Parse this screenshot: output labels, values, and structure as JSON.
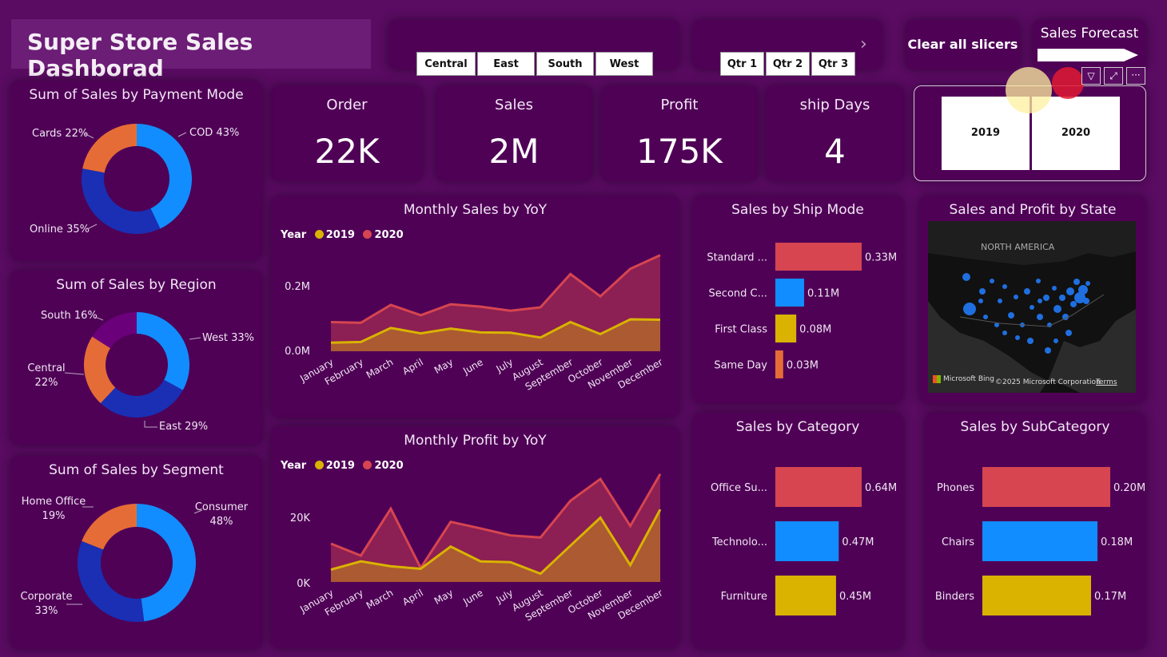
{
  "header": {
    "title": "Super Store Sales Dashborad"
  },
  "region_slicer": [
    "Central",
    "East",
    "South",
    "West"
  ],
  "quarter_slicer": [
    "Qtr 1",
    "Qtr 2",
    "Qtr 3"
  ],
  "clear_button": "Clear all slicers",
  "forecast": {
    "label": "Sales Forecast"
  },
  "kpis": [
    {
      "label": "Order",
      "value": "22K"
    },
    {
      "label": "Sales",
      "value": "2M"
    },
    {
      "label": "Profit",
      "value": "175K"
    },
    {
      "label": "ship Days",
      "value": "4"
    }
  ],
  "year_slicer": [
    "2019",
    "2020"
  ],
  "colors": {
    "bg": "#5a0b62",
    "panel": "#4f0156",
    "blue": "#118dff",
    "darkblue": "#1a2fb3",
    "orange": "#e66c37",
    "purple": "#6b007b",
    "red": "#d64550",
    "gold": "#d9b300"
  },
  "map": {
    "title": "Sales and Profit by State",
    "region_label": "NORTH AMERICA",
    "attribution": "Microsoft Bing",
    "copyright": "©2025 Microsoft Corporation",
    "terms": "Terms"
  },
  "chart_data": [
    {
      "id": "payment",
      "type": "pie",
      "title": "Sum of Sales by Payment Mode",
      "slices": [
        {
          "label": "COD 43%",
          "value": 43,
          "color": "#118dff"
        },
        {
          "label": "Online 35%",
          "value": 35,
          "color": "#1a2fb3"
        },
        {
          "label": "Cards 22%",
          "value": 22,
          "color": "#e66c37"
        }
      ]
    },
    {
      "id": "region",
      "type": "pie",
      "title": "Sum of Sales by Region",
      "slices": [
        {
          "label": "West 33%",
          "value": 33,
          "color": "#118dff"
        },
        {
          "label": "East 29%",
          "value": 29,
          "color": "#1a2fb3"
        },
        {
          "label": "Central 22%",
          "value": 22,
          "color": "#e66c37"
        },
        {
          "label": "South 16%",
          "value": 16,
          "color": "#6b007b"
        }
      ]
    },
    {
      "id": "segment",
      "type": "pie",
      "title": "Sum of Sales by Segment",
      "slices": [
        {
          "label": "Consumer 48%",
          "value": 48,
          "color": "#118dff"
        },
        {
          "label": "Corporate 33%",
          "value": 33,
          "color": "#1a2fb3"
        },
        {
          "label": "Home Office 19%",
          "value": 19,
          "color": "#e66c37"
        }
      ]
    },
    {
      "id": "monthly_sales",
      "type": "area",
      "title": "Monthly Sales by YoY",
      "legend_title": "Year",
      "categories": [
        "January",
        "February",
        "March",
        "April",
        "May",
        "June",
        "July",
        "August",
        "September",
        "October",
        "November",
        "December"
      ],
      "y_ticks": [
        "0.0M",
        "0.2M"
      ],
      "ylim": [
        0,
        0.3
      ],
      "series": [
        {
          "name": "2019",
          "color": "#d9b300",
          "values": [
            0.025,
            0.027,
            0.068,
            0.052,
            0.066,
            0.055,
            0.054,
            0.04,
            0.085,
            0.05,
            0.093,
            0.092
          ]
        },
        {
          "name": "2020",
          "color": "#d64550",
          "values": [
            0.085,
            0.083,
            0.135,
            0.105,
            0.137,
            0.13,
            0.118,
            0.128,
            0.225,
            0.16,
            0.24,
            0.28
          ]
        }
      ]
    },
    {
      "id": "monthly_profit",
      "type": "area",
      "title": "Monthly Profit by YoY",
      "legend_title": "Year",
      "categories": [
        "January",
        "February",
        "March",
        "April",
        "May",
        "June",
        "July",
        "August",
        "September",
        "October",
        "November",
        "December"
      ],
      "y_ticks": [
        "0K",
        "20K"
      ],
      "ylim": [
        0,
        25000
      ],
      "series": [
        {
          "name": "2019",
          "color": "#d9b300",
          "values": [
            3000,
            5000,
            3800,
            3200,
            8600,
            5000,
            4800,
            2000,
            8800,
            15600,
            4100,
            17600
          ]
        },
        {
          "name": "2020",
          "color": "#d64550",
          "values": [
            9300,
            6400,
            17800,
            3400,
            14600,
            13000,
            11300,
            10800,
            19700,
            25000,
            13600,
            26200
          ]
        }
      ]
    },
    {
      "id": "ship_mode",
      "type": "bar",
      "title": "Sales by Ship Mode",
      "xlim": [
        0,
        0.33
      ],
      "bars": [
        {
          "category": "Standard ...",
          "value": 0.33,
          "label": "0.33M",
          "color": "#d64550"
        },
        {
          "category": "Second C...",
          "value": 0.11,
          "label": "0.11M",
          "color": "#118dff"
        },
        {
          "category": "First Class",
          "value": 0.08,
          "label": "0.08M",
          "color": "#d9b300"
        },
        {
          "category": "Same Day",
          "value": 0.03,
          "label": "0.03M",
          "color": "#e66c37"
        }
      ]
    },
    {
      "id": "category",
      "type": "bar",
      "title": "Sales by Category",
      "xlim": [
        0,
        0.64
      ],
      "bars": [
        {
          "category": "Office Su...",
          "value": 0.64,
          "label": "0.64M",
          "color": "#d64550"
        },
        {
          "category": "Technolo...",
          "value": 0.47,
          "label": "0.47M",
          "color": "#118dff"
        },
        {
          "category": "Furniture",
          "value": 0.45,
          "label": "0.45M",
          "color": "#d9b300"
        }
      ]
    },
    {
      "id": "subcategory",
      "type": "bar",
      "title": "Sales by SubCategory",
      "xlim": [
        0,
        0.2
      ],
      "bars": [
        {
          "category": "Phones",
          "value": 0.2,
          "label": "0.20M",
          "color": "#d64550"
        },
        {
          "category": "Chairs",
          "value": 0.18,
          "label": "0.18M",
          "color": "#118dff"
        },
        {
          "category": "Binders",
          "value": 0.17,
          "label": "0.17M",
          "color": "#d9b300"
        }
      ]
    }
  ]
}
